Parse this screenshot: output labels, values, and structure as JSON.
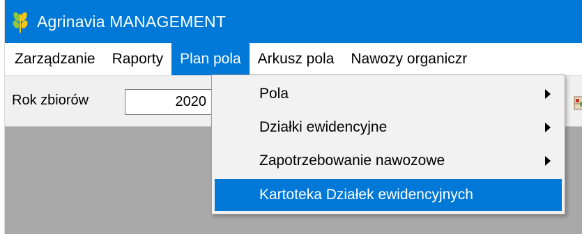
{
  "window": {
    "title": "Agrinavia MANAGEMENT",
    "icon": "wheat-icon"
  },
  "menubar": {
    "items": [
      {
        "label": "Zarządzanie"
      },
      {
        "label": "Raporty"
      },
      {
        "label": "Plan pola",
        "active": true
      },
      {
        "label": "Arkusz pola"
      },
      {
        "label": "Nawozy organiczr"
      }
    ]
  },
  "toolbar": {
    "rok_label": "Rok zbiorów",
    "rok_value": "2020",
    "tool_icon": "map-icon"
  },
  "dropdown": {
    "items": [
      {
        "label": "Pola",
        "submenu": true
      },
      {
        "label": "Działki ewidencyjne",
        "submenu": true
      },
      {
        "label": "Zapotrzebowanie nawozowe",
        "submenu": true
      },
      {
        "label": "Kartoteka Działek ewidencyjnych",
        "submenu": false,
        "highlighted": true
      }
    ]
  },
  "colors": {
    "accent": "#0078d7",
    "workspace": "#a9a9a9",
    "toolbar": "#f0f0f0",
    "menu_bg": "#f2f2f2"
  }
}
